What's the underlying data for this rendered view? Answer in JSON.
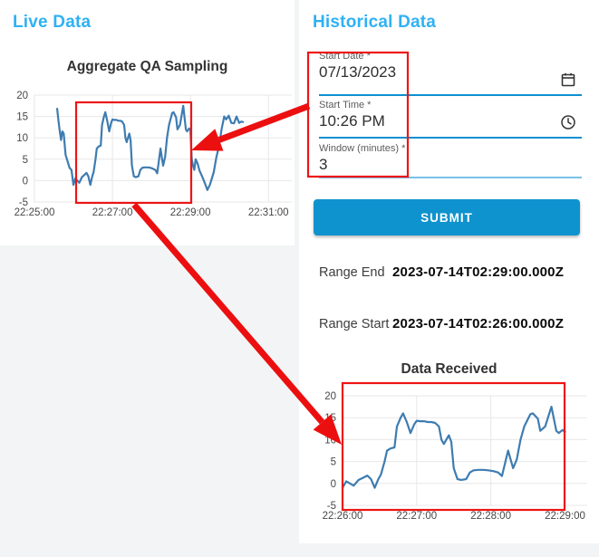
{
  "live_panel": {
    "heading": "Live Data"
  },
  "historical_panel": {
    "heading": "Historical Data",
    "form": {
      "start_date": {
        "label": "Start Date *",
        "value": "07/13/2023"
      },
      "start_time": {
        "label": "Start Time *",
        "value": "10:26 PM"
      },
      "window_minutes": {
        "label": "Window (minutes) *",
        "value": "3"
      },
      "submit_label": "SUBMIT"
    },
    "results": {
      "range_end_label": "Range End",
      "range_end_value": "2023-07-14T02:29:00.000Z",
      "range_start_label": "Range Start",
      "range_start_value": "2023-07-14T02:26:00.000Z"
    }
  },
  "icons": {
    "calendar": "calendar-icon",
    "clock": "clock-icon"
  },
  "colors": {
    "heading_blue": "#2fb1f4",
    "submit_bg": "#0f93ce",
    "underline_active": "#0e8fd0",
    "underline_idle": "#79c1e9",
    "series_line": "#3e7cb1",
    "annotation_red": "#ee1515",
    "grid": "#e7e7e7"
  },
  "chart_data": [
    {
      "type": "line",
      "title": "Aggregate QA Sampling",
      "xlabel": "",
      "ylabel": "",
      "x_unit": "seconds after 22:25:00",
      "grid": true,
      "legend": false,
      "line_color": "#3e7cb1",
      "x_range": [
        0,
        396
      ],
      "y_range": [
        -5,
        20
      ],
      "y_ticks": [
        20,
        15,
        10,
        5,
        0,
        -5
      ],
      "x_ticks": [
        {
          "x": 0,
          "label": "22:25:00"
        },
        {
          "x": 120,
          "label": "22:27:00"
        },
        {
          "x": 240,
          "label": "22:29:00"
        },
        {
          "x": 360,
          "label": "22:31:00"
        }
      ],
      "points": [
        [
          35,
          16.8
        ],
        [
          37,
          14
        ],
        [
          39,
          11.5
        ],
        [
          41,
          9.5
        ],
        [
          43,
          11.5
        ],
        [
          45,
          11
        ],
        [
          48,
          6
        ],
        [
          51,
          4.5
        ],
        [
          54,
          3
        ],
        [
          57,
          2.5
        ],
        [
          60,
          -1
        ],
        [
          63,
          0.5
        ],
        [
          66,
          0
        ],
        [
          69,
          -0.5
        ],
        [
          73,
          0.8
        ],
        [
          76,
          1.2
        ],
        [
          80,
          1.8
        ],
        [
          83,
          1
        ],
        [
          86,
          -1
        ],
        [
          89,
          1
        ],
        [
          91,
          2
        ],
        [
          94,
          5
        ],
        [
          96,
          7.5
        ],
        [
          99,
          8
        ],
        [
          102,
          8.2
        ],
        [
          104,
          13
        ],
        [
          107,
          15
        ],
        [
          109,
          16
        ],
        [
          112,
          14
        ],
        [
          115,
          11.5
        ],
        [
          118,
          13.5
        ],
        [
          120,
          14.3
        ],
        [
          123,
          14.2
        ],
        [
          126,
          14.2
        ],
        [
          129,
          14
        ],
        [
          132,
          14
        ],
        [
          135,
          13.8
        ],
        [
          138,
          13
        ],
        [
          140,
          10
        ],
        [
          142,
          9
        ],
        [
          146,
          11
        ],
        [
          148,
          9.5
        ],
        [
          150,
          3.5
        ],
        [
          153,
          1
        ],
        [
          156,
          0.8
        ],
        [
          160,
          1
        ],
        [
          163,
          2.5
        ],
        [
          166,
          3
        ],
        [
          170,
          3.1
        ],
        [
          174,
          3.1
        ],
        [
          178,
          3
        ],
        [
          182,
          2.8
        ],
        [
          186,
          2.5
        ],
        [
          189,
          1.7
        ],
        [
          194,
          7.5
        ],
        [
          198,
          3.5
        ],
        [
          201,
          5.5
        ],
        [
          204,
          10
        ],
        [
          207,
          13
        ],
        [
          212,
          15.8
        ],
        [
          214,
          16
        ],
        [
          218,
          14.8
        ],
        [
          220,
          12
        ],
        [
          224,
          13
        ],
        [
          229,
          17.5
        ],
        [
          233,
          12
        ],
        [
          235,
          11.5
        ],
        [
          238,
          12.2
        ],
        [
          240,
          11.8
        ],
        [
          242,
          5
        ],
        [
          244,
          3.5
        ],
        [
          246,
          2.5
        ],
        [
          248,
          5
        ],
        [
          251,
          4
        ],
        [
          254,
          2.3
        ],
        [
          258,
          1
        ],
        [
          262,
          -0.5
        ],
        [
          266,
          -2.2
        ],
        [
          270,
          -1
        ],
        [
          273,
          0.5
        ],
        [
          276,
          2
        ],
        [
          280,
          5.5
        ],
        [
          284,
          8
        ],
        [
          288,
          12
        ],
        [
          292,
          15
        ],
        [
          295,
          14.3
        ],
        [
          299,
          15.2
        ],
        [
          303,
          13.5
        ],
        [
          307,
          13.4
        ],
        [
          311,
          15
        ],
        [
          315,
          13.5
        ],
        [
          318,
          13.8
        ],
        [
          321,
          13.7
        ]
      ]
    },
    {
      "type": "line",
      "title": "Data Received",
      "xlabel": "",
      "ylabel": "",
      "x_unit": "seconds after 22:26:00",
      "grid": true,
      "legend": false,
      "line_color": "#3e7cb1",
      "x_range": [
        0,
        198
      ],
      "y_range": [
        -5,
        20
      ],
      "y_ticks": [
        20,
        15,
        10,
        5,
        0,
        -5
      ],
      "x_ticks": [
        {
          "x": 0,
          "label": "22:26:00"
        },
        {
          "x": 60,
          "label": "22:27:00"
        },
        {
          "x": 120,
          "label": "22:28:00"
        },
        {
          "x": 180,
          "label": "22:29:00"
        }
      ],
      "points": [
        [
          0,
          -1
        ],
        [
          3,
          0.5
        ],
        [
          6,
          0
        ],
        [
          9,
          -0.5
        ],
        [
          13,
          0.8
        ],
        [
          16,
          1.2
        ],
        [
          20,
          1.8
        ],
        [
          23,
          1
        ],
        [
          26,
          -1
        ],
        [
          29,
          1
        ],
        [
          31,
          2
        ],
        [
          34,
          5
        ],
        [
          36,
          7.5
        ],
        [
          39,
          8
        ],
        [
          42,
          8.2
        ],
        [
          44,
          13
        ],
        [
          47,
          15
        ],
        [
          49,
          16
        ],
        [
          52,
          14
        ],
        [
          55,
          11.5
        ],
        [
          58,
          13.5
        ],
        [
          60,
          14.3
        ],
        [
          63,
          14.2
        ],
        [
          66,
          14.2
        ],
        [
          69,
          14
        ],
        [
          72,
          14
        ],
        [
          75,
          13.8
        ],
        [
          78,
          13
        ],
        [
          80,
          10
        ],
        [
          82,
          9
        ],
        [
          86,
          11
        ],
        [
          88,
          9.5
        ],
        [
          90,
          3.5
        ],
        [
          93,
          1
        ],
        [
          96,
          0.8
        ],
        [
          100,
          1
        ],
        [
          103,
          2.5
        ],
        [
          106,
          3
        ],
        [
          110,
          3.1
        ],
        [
          114,
          3.1
        ],
        [
          118,
          3
        ],
        [
          122,
          2.8
        ],
        [
          126,
          2.5
        ],
        [
          129,
          1.7
        ],
        [
          134,
          7.5
        ],
        [
          138,
          3.5
        ],
        [
          141,
          5.5
        ],
        [
          144,
          10
        ],
        [
          147,
          13
        ],
        [
          152,
          15.8
        ],
        [
          154,
          16
        ],
        [
          158,
          14.8
        ],
        [
          160,
          12
        ],
        [
          164,
          13
        ],
        [
          169,
          17.5
        ],
        [
          173,
          12
        ],
        [
          175,
          11.5
        ],
        [
          178,
          12.2
        ],
        [
          180,
          11.8
        ]
      ]
    }
  ]
}
